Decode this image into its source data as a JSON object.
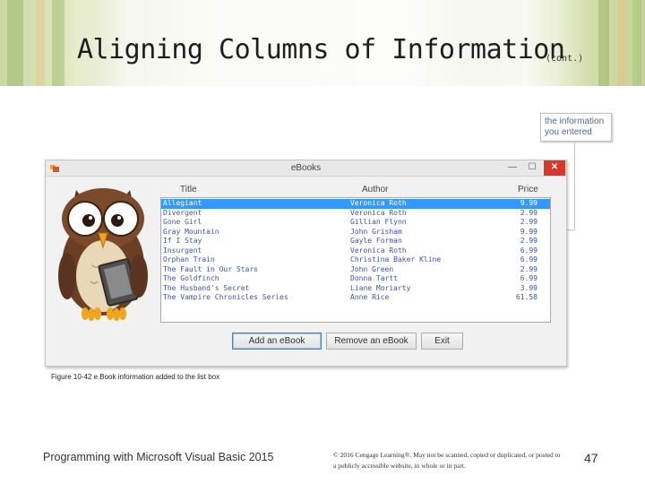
{
  "slide": {
    "title": "Aligning Columns of Information",
    "title_suffix": "(cont.)",
    "callout": [
      "the information",
      "you entered"
    ],
    "caption": "Figure 10-42 e.Book information added to the list box",
    "footer_left": "Programming with Microsoft Visual Basic 2015",
    "footer_copyright": "© 2016 Cengage Learning®. May not be scanned, copied or duplicated, or posted to a publicly accessible website, in whole or in part.",
    "page_number": "47"
  },
  "window": {
    "title": "eBooks",
    "controls": {
      "minimize": "—",
      "maximize": "☐",
      "close": "✕"
    },
    "columns": {
      "title": "Title",
      "author": "Author",
      "price": "Price"
    },
    "selected_index": 0,
    "books": [
      {
        "title": "Allegiant",
        "author": "Veronica Roth",
        "price": "9.99"
      },
      {
        "title": "Divergent",
        "author": "Veronica Roth",
        "price": "2.99"
      },
      {
        "title": "Gone Girl",
        "author": "Gillian Flynn",
        "price": "2.99"
      },
      {
        "title": "Gray Mountain",
        "author": "John Grisham",
        "price": "9.99"
      },
      {
        "title": "If I Stay",
        "author": "Gayle Forman",
        "price": "2.99"
      },
      {
        "title": "Insurgent",
        "author": "Veronica Roth",
        "price": "6.99"
      },
      {
        "title": "Orphan Train",
        "author": "Christina Baker Kline",
        "price": "6.99"
      },
      {
        "title": "The Fault in Our Stars",
        "author": "John Green",
        "price": "2.99"
      },
      {
        "title": "The Goldfinch",
        "author": "Donna Tartt",
        "price": "6.99"
      },
      {
        "title": "The Husband's Secret",
        "author": "Liane Moriarty",
        "price": "3.99"
      },
      {
        "title": "The Vampire Chronicles Series",
        "author": "Anne Rice",
        "price": "61.58"
      }
    ],
    "buttons": {
      "add": "Add an eBook",
      "remove": "Remove an eBook",
      "exit": "Exit"
    }
  },
  "colors": {
    "selection": "#3399ff",
    "list_text": "#3a54b8",
    "close_button": "#d9372b"
  }
}
